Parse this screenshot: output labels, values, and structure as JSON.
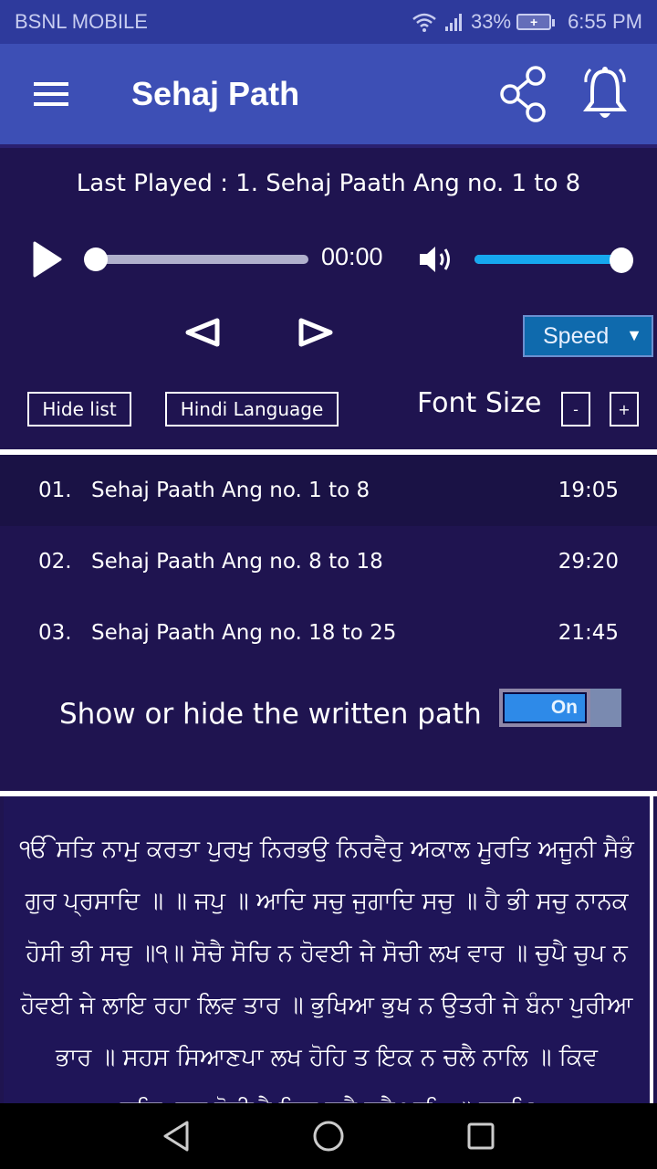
{
  "status_bar": {
    "carrier": "BSNL MOBILE",
    "battery_percent": "33%",
    "time": "6:55 PM",
    "icons": [
      "wifi-icon",
      "signal-icon",
      "battery-charging-icon"
    ]
  },
  "app_bar": {
    "title": "Sehaj Path",
    "icons": [
      "menu-icon",
      "share-icon",
      "bell-icon"
    ]
  },
  "player": {
    "last_played": "Last Played : 1. Sehaj Paath Ang no. 1 to 8",
    "current_time": "00:00",
    "seek_progress": 0,
    "volume_level": 1.0,
    "speed_label": "Speed",
    "speed_arrow": "▼",
    "hide_list_label": "Hide list",
    "language_label": "Hindi Language",
    "font_size_label": "Font Size",
    "font_minus": "-",
    "font_plus": "+"
  },
  "tracks": [
    {
      "num": "01.",
      "title": "Sehaj Paath Ang no. 1 to 8",
      "duration": "19:05",
      "active": true
    },
    {
      "num": "02.",
      "title": "Sehaj Paath Ang no. 8 to 18",
      "duration": "29:20",
      "active": false
    },
    {
      "num": "03.",
      "title": "Sehaj Paath Ang no. 18 to 25",
      "duration": "21:45",
      "active": false
    }
  ],
  "written_path_toggle": {
    "label": "Show or hide the written path",
    "state": "On"
  },
  "path_text": "ੴ ਸਤਿ ਨਾਮੁ ਕਰਤਾ ਪੁਰਖੁ ਨਿਰਭਉ ਨਿਰਵੈਰੁ ਅਕਾਲ ਮੂਰਤਿ ਅਜੂਨੀ ਸੈਭੰ ਗੁਰ ਪ੍ਰਸਾਦਿ ॥ ॥ ਜਪੁ ॥ ਆਦਿ ਸਚੁ ਜੁਗਾਦਿ ਸਚੁ ॥ ਹੈ ਭੀ ਸਚੁ ਨਾਨਕ ਹੋਸੀ ਭੀ ਸਚੁ ॥੧॥ ਸੋਚੈ ਸੋਚਿ ਨ ਹੋਵਈ ਜੇ ਸੋਚੀ ਲਖ ਵਾਰ ॥ ਚੁਪੈ ਚੁਪ ਨ ਹੋਵਈ ਜੇ ਲਾਇ ਰਹਾ ਲਿਵ ਤਾਰ ॥ ਭੁਖਿਆ ਭੁਖ ਨ ਉਤਰੀ ਜੇ ਬੰਨਾ ਪੁਰੀਆ ਭਾਰ ॥ ਸਹਸ ਸਿਆਣਪਾ ਲਖ ਹੋਹਿ ਤ ਇਕ ਨ ਚਲੈ ਨਾਲਿ ॥ ਕਿਵ ਸਚਿਆਰਾ ਹੋਈਐ ਕਿਵ ਕੂੜੈ ਤੁਟੈ ਪਾਲਿ ॥ ਹੁਕਮਿ",
  "nav_bar": {
    "icons": [
      "back-icon",
      "home-icon",
      "recents-icon"
    ]
  },
  "colors": {
    "status_bar": "#2e3a9c",
    "app_bar": "#3d4fb5",
    "background": "#1f1450",
    "accent_volume": "#16a8ef",
    "speed_bg": "#0f6aad",
    "toggle_on": "#2e8ae8"
  }
}
